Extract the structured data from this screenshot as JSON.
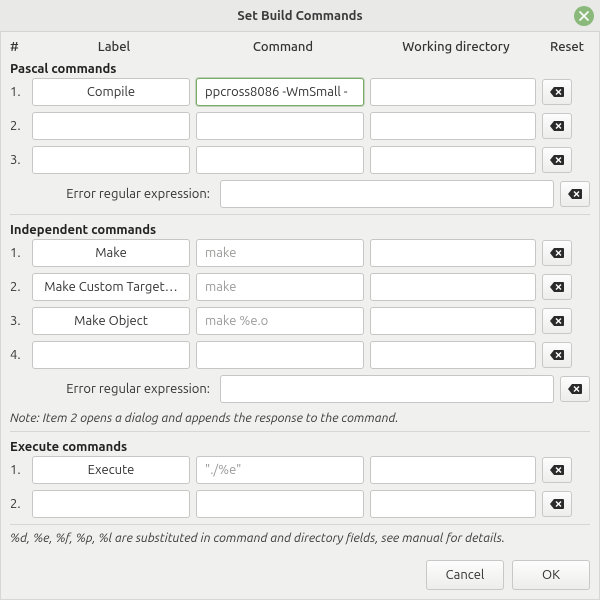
{
  "window": {
    "title": "Set Build Commands"
  },
  "headers": {
    "num": "#",
    "label": "Label",
    "command": "Command",
    "wd": "Working directory",
    "reset": "Reset"
  },
  "regex_label": "Error regular expression:",
  "pascal": {
    "heading": "Pascal commands",
    "rows": [
      {
        "n": "1.",
        "label": "Compile",
        "cmd": "ppcross8086 -WmSmall -",
        "cmd_focused": true,
        "wd": ""
      },
      {
        "n": "2.",
        "label": "",
        "cmd": "",
        "wd": ""
      },
      {
        "n": "3.",
        "label": "",
        "cmd": "",
        "wd": ""
      }
    ],
    "regex": ""
  },
  "independent": {
    "heading": "Independent commands",
    "rows": [
      {
        "n": "1.",
        "label": "Make",
        "cmd_placeholder": "make",
        "wd": ""
      },
      {
        "n": "2.",
        "label": "Make Custom Target…",
        "cmd_placeholder": "make",
        "wd": ""
      },
      {
        "n": "3.",
        "label": "Make Object",
        "cmd_placeholder": "make %e.o",
        "wd": ""
      },
      {
        "n": "4.",
        "label": "",
        "cmd": "",
        "wd": ""
      }
    ],
    "regex": "",
    "note": "Note: Item 2 opens a dialog and appends the response to the command."
  },
  "execute": {
    "heading": "Execute commands",
    "rows": [
      {
        "n": "1.",
        "label": "Execute",
        "cmd_placeholder": "\"./%e\"",
        "wd": ""
      },
      {
        "n": "2.",
        "label": "",
        "cmd": "",
        "wd": ""
      }
    ]
  },
  "footnote": "%d, %e, %f, %p, %l are substituted in command and directory fields, see manual for details.",
  "buttons": {
    "cancel": "Cancel",
    "ok": "OK"
  }
}
